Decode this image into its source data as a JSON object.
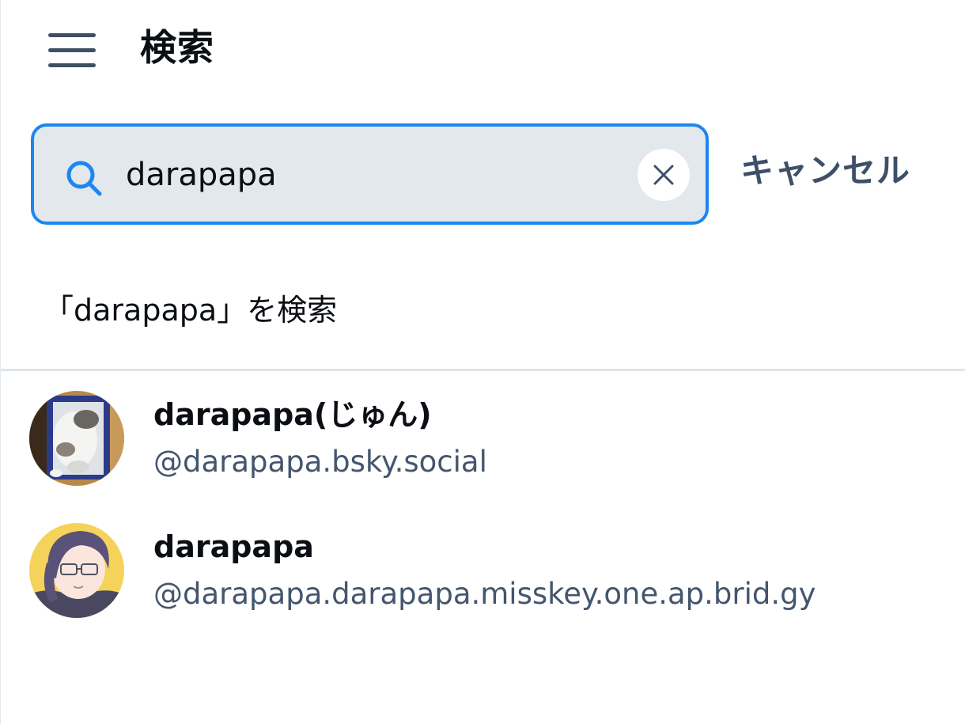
{
  "header": {
    "title": "検索",
    "menu_icon": "hamburger-menu-icon"
  },
  "search": {
    "value": "darapapa",
    "placeholder": "",
    "search_icon": "search-icon",
    "clear_icon": "clear-x-icon",
    "cancel_label": "キャンセル"
  },
  "suggestion": {
    "label": "「darapapa」を検索"
  },
  "results": [
    {
      "display_name": "darapapa(じゅん)",
      "handle": "@darapapa.bsky.social",
      "avatar": "cat-in-box-avatar"
    },
    {
      "display_name": "darapapa",
      "handle": "@darapapa.darapapa.misskey.one.ap.brid.gy",
      "avatar": "anime-glasses-avatar"
    }
  ],
  "colors": {
    "accent": "#1d86f0",
    "input_bg": "#e3e8ec",
    "secondary_text": "#44566d",
    "cancel_text": "#3d5068",
    "divider": "#dfe5ea"
  }
}
